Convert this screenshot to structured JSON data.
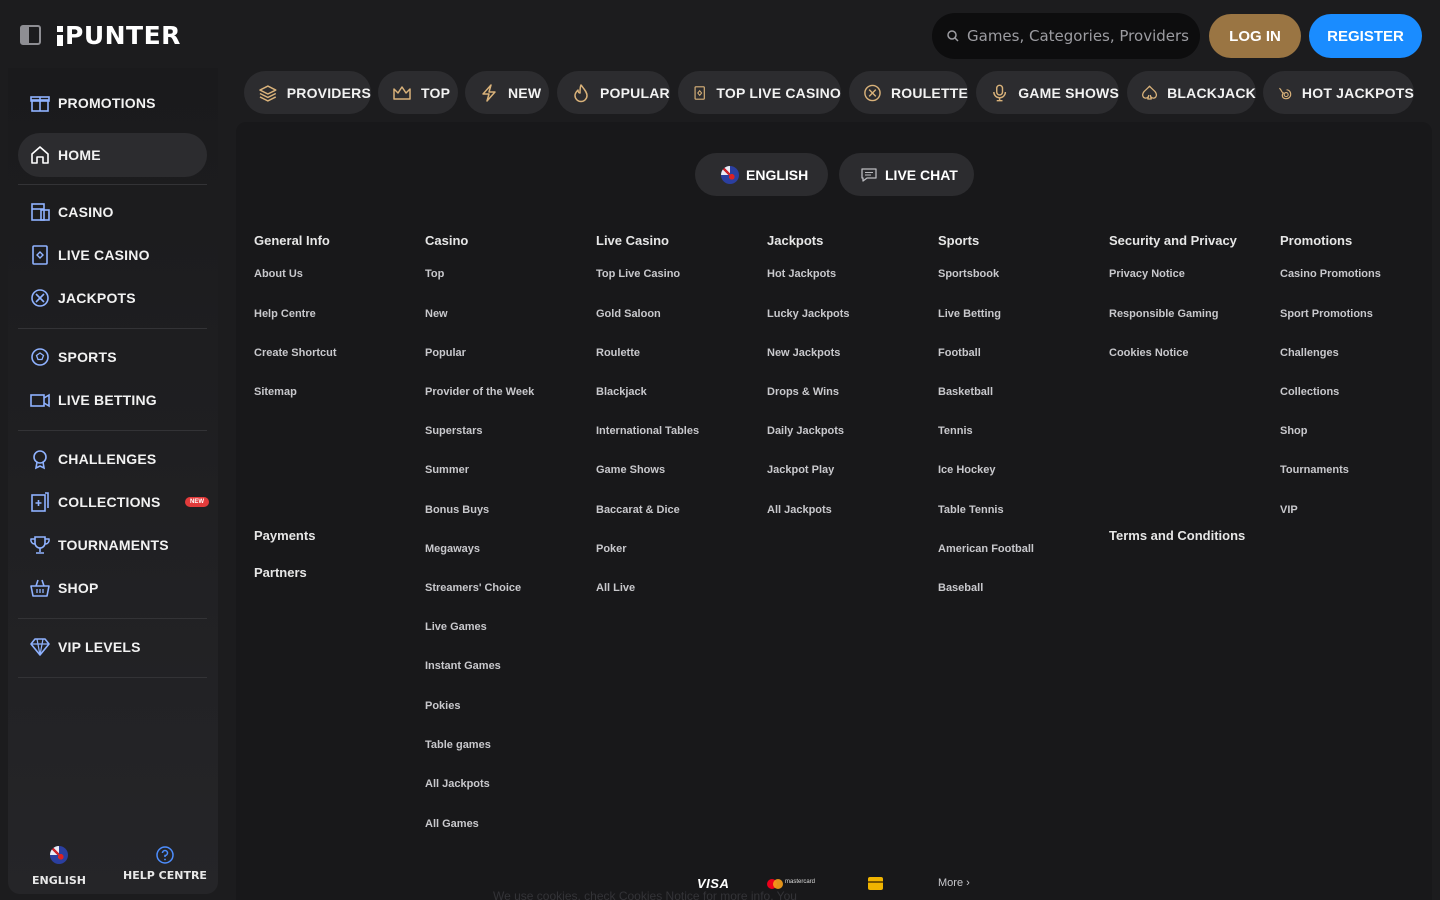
{
  "header": {
    "logo": "PUNTER",
    "search_placeholder": "Games, Categories, Providers",
    "login_label": "LOG IN",
    "register_label": "REGISTER"
  },
  "sidebar": {
    "items": [
      {
        "label": "PROMOTIONS",
        "icon": "gift-icon"
      },
      {
        "label": "HOME",
        "icon": "home-icon",
        "active": true
      },
      {
        "label": "CASINO",
        "icon": "casino-icon"
      },
      {
        "label": "LIVE CASINO",
        "icon": "live-casino-icon"
      },
      {
        "label": "JACKPOTS",
        "icon": "jackpots-icon"
      },
      {
        "label": "SPORTS",
        "icon": "sports-ball-icon"
      },
      {
        "label": "LIVE BETTING",
        "icon": "live-betting-icon"
      },
      {
        "label": "CHALLENGES",
        "icon": "medal-icon"
      },
      {
        "label": "COLLECTIONS",
        "icon": "collections-icon",
        "badge": "NEW"
      },
      {
        "label": "TOURNAMENTS",
        "icon": "trophy-icon"
      },
      {
        "label": "SHOP",
        "icon": "shop-basket-icon"
      },
      {
        "label": "VIP LEVELS",
        "icon": "diamond-icon"
      }
    ],
    "footer": {
      "language_label": "ENGLISH",
      "help_label": "HELP CENTRE"
    }
  },
  "categories": [
    {
      "label": "PROVIDERS",
      "icon": "providers-stack-icon"
    },
    {
      "label": "TOP",
      "icon": "crown-icon"
    },
    {
      "label": "NEW",
      "icon": "lightning-icon"
    },
    {
      "label": "POPULAR",
      "icon": "flame-icon"
    },
    {
      "label": "TOP LIVE CASINO",
      "icon": "live-card-icon"
    },
    {
      "label": "ROULETTE",
      "icon": "roulette-icon"
    },
    {
      "label": "GAME SHOWS",
      "icon": "microphone-icon"
    },
    {
      "label": "BLACKJACK",
      "icon": "spade-icon"
    },
    {
      "label": "HOT JACKPOTS",
      "icon": "hot-jackpot-icon"
    }
  ],
  "main": {
    "language_button": "ENGLISH",
    "live_chat_button": "LIVE CHAT"
  },
  "footer_links": {
    "general_info": {
      "title": "General Info",
      "links": [
        "About Us",
        "Help Centre",
        "Create Shortcut",
        "Sitemap"
      ]
    },
    "payments": "Payments",
    "partners": "Partners",
    "casino": {
      "title": "Casino",
      "links": [
        "Top",
        "New",
        "Popular",
        "Provider of the Week",
        "Superstars",
        "Summer",
        "Bonus Buys",
        "Megaways",
        "Streamers' Choice",
        "Live Games",
        "Instant Games",
        "Pokies",
        "Table games",
        "All Jackpots",
        "All Games"
      ]
    },
    "live_casino": {
      "title": "Live Casino",
      "links": [
        "Top Live Casino",
        "Gold Saloon",
        "Roulette",
        "Blackjack",
        "International Tables",
        "Game Shows",
        "Baccarat & Dice",
        "Poker",
        "All Live"
      ]
    },
    "jackpots": {
      "title": "Jackpots",
      "links": [
        "Hot Jackpots",
        "Lucky Jackpots",
        "New Jackpots",
        "Drops & Wins",
        "Daily Jackpots",
        "Jackpot Play",
        "All Jackpots"
      ]
    },
    "sports": {
      "title": "Sports",
      "links": [
        "Sportsbook",
        "Live Betting",
        "Football",
        "Basketball",
        "Tennis",
        "Ice Hockey",
        "Table Tennis",
        "American Football",
        "Baseball"
      ]
    },
    "security": {
      "title": "Security and Privacy",
      "links": [
        "Privacy Notice",
        "Responsible Gaming",
        "Cookies Notice"
      ]
    },
    "terms": "Terms and Conditions",
    "promotions": {
      "title": "Promotions",
      "links": [
        "Casino Promotions",
        "Sport Promotions",
        "Challenges",
        "Collections",
        "Shop",
        "Tournaments",
        "VIP"
      ]
    }
  },
  "payments_bar": {
    "visa": "VISA",
    "mastercard": "mastercard",
    "more": "More"
  },
  "cookie_banner": "We use cookies, check Cookies Notice for more info. You"
}
